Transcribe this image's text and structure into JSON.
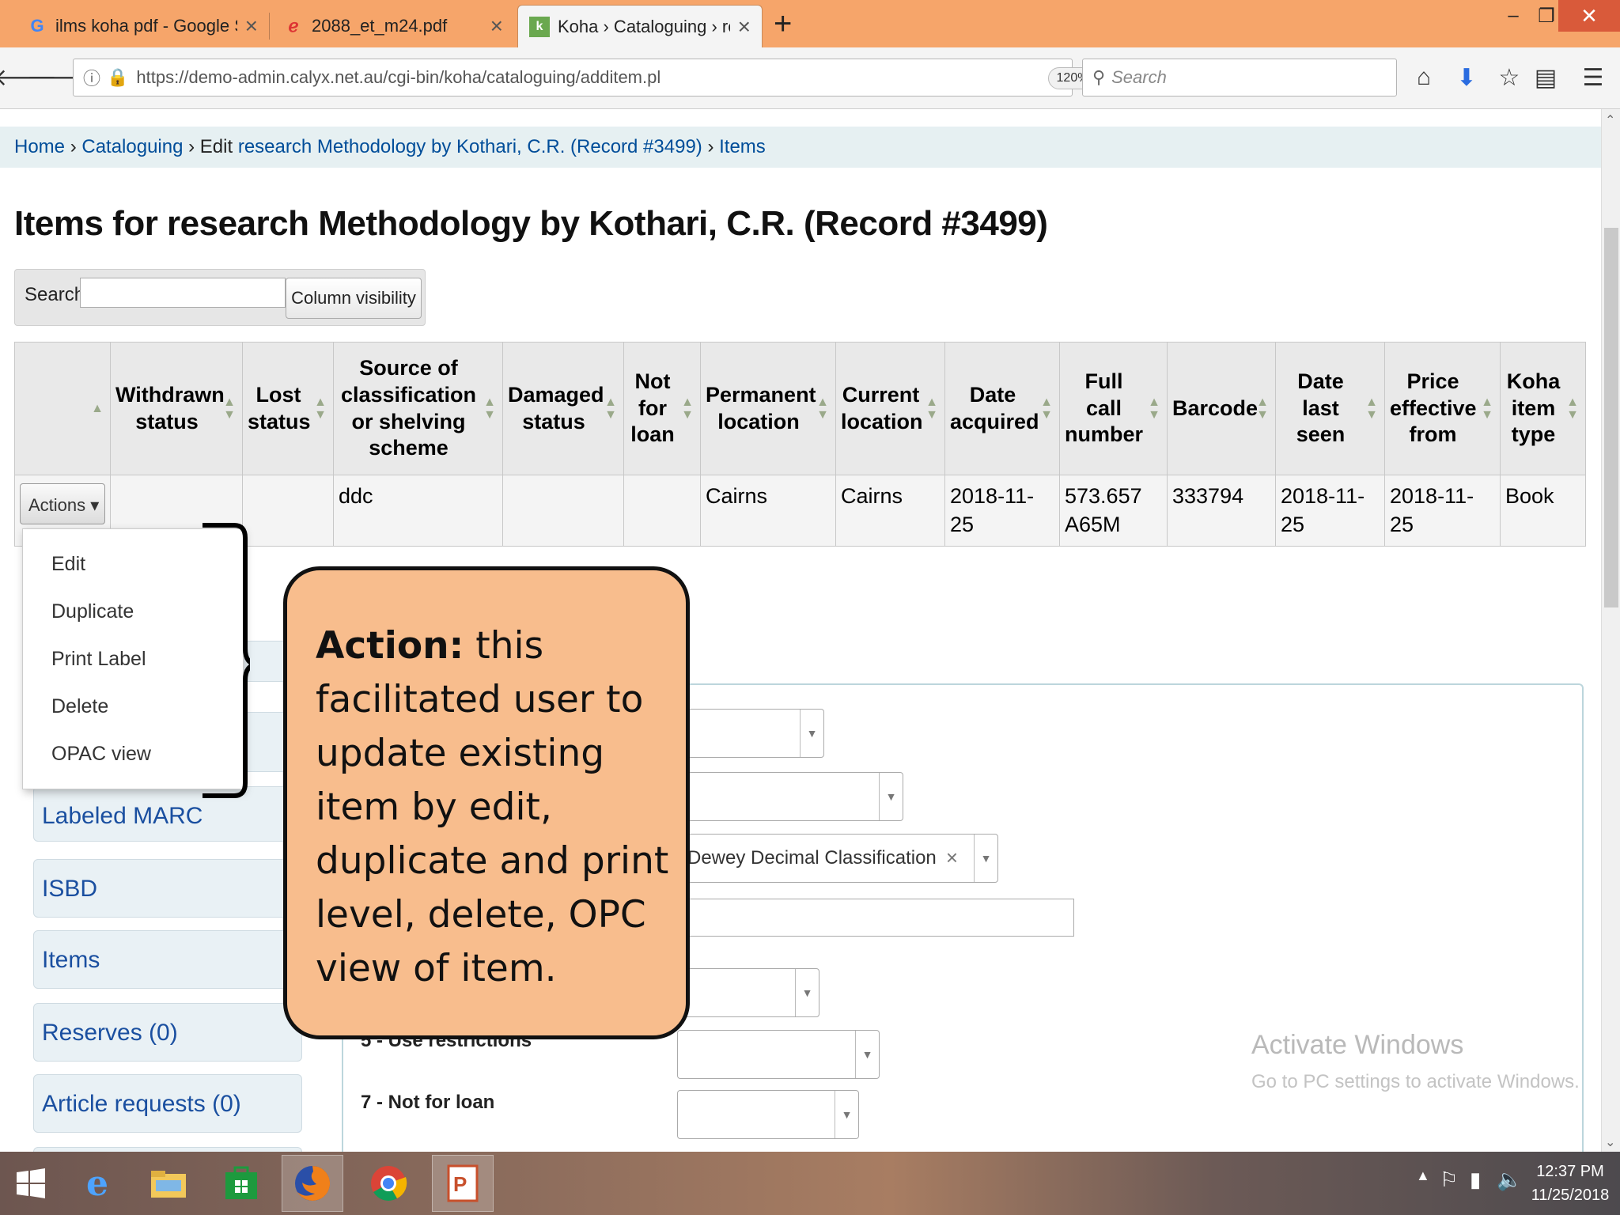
{
  "browser": {
    "tabs": [
      {
        "title": "ilms koha pdf - Google Sear",
        "icon": "google-icon"
      },
      {
        "title": "2088_et_m24.pdf",
        "icon": "pdf-icon"
      },
      {
        "title": "Koha › Cataloguing › researc",
        "icon": "koha-icon"
      }
    ],
    "url": "https://demo-admin.calyx.net.au/cgi-bin/koha/cataloguing/additem.pl",
    "zoom": "120%",
    "search_placeholder": "Search"
  },
  "breadcrumb": {
    "home": "Home",
    "sep1": " › ",
    "cataloguing": "Cataloguing",
    "sep2": " › Edit ",
    "record": "research Methodology by Kothari, C.R. (Record #3499)",
    "sep3": " › ",
    "items": "Items"
  },
  "page_title": "Items for research Methodology by Kothari, C.R. (Record #3499)",
  "table_tools": {
    "search_label": "Search:",
    "column_visibility": "Column visibility"
  },
  "table": {
    "headers": [
      "",
      "Withdrawn status",
      "Lost status",
      "Source of classification or shelving scheme",
      "Damaged status",
      "Not for loan",
      "Permanent location",
      "Current location",
      "Date acquired",
      "Full call number",
      "Barcode",
      "Date last seen",
      "Price effective from",
      "Koha item type"
    ],
    "row": {
      "actions": "Actions ▾",
      "withdrawn": "",
      "lost": "",
      "source": "ddc",
      "damaged": "",
      "notforloan": "",
      "permanent": "Cairns",
      "current": "Cairns",
      "acquired": "2018-11-25",
      "callnumber": "573.657 A65M",
      "barcode": "333794",
      "lastseen": "2018-11-25",
      "pricefrom": "2018-11-25",
      "itemtype": "Book"
    }
  },
  "actions_menu": [
    "Edit",
    "Duplicate",
    "Print Label",
    "Delete",
    "OPAC view"
  ],
  "left_nav": [
    "Labeled MARC",
    "ISBD",
    "Items",
    "Reserves (0)",
    "Article requests (0)"
  ],
  "form": {
    "classification_value": "Dewey Decimal Classification",
    "use_restrictions_label": "5 - Use restrictions",
    "not_for_loan_label": "7 - Not for loan"
  },
  "callout": {
    "bold": "Action:",
    "text": " this facilitated user to update existing item by edit, duplicate and print level, delete, OPC view of item."
  },
  "watermark": {
    "line1": "Activate Windows",
    "line2": "Go to PC settings to activate Windows."
  },
  "taskbar": {
    "time": "12:37 PM",
    "date": "11/25/2018"
  },
  "colors": {
    "tabbar": "#f6a56a",
    "callout_fill": "#f8bd8d",
    "link": "#004d99"
  }
}
